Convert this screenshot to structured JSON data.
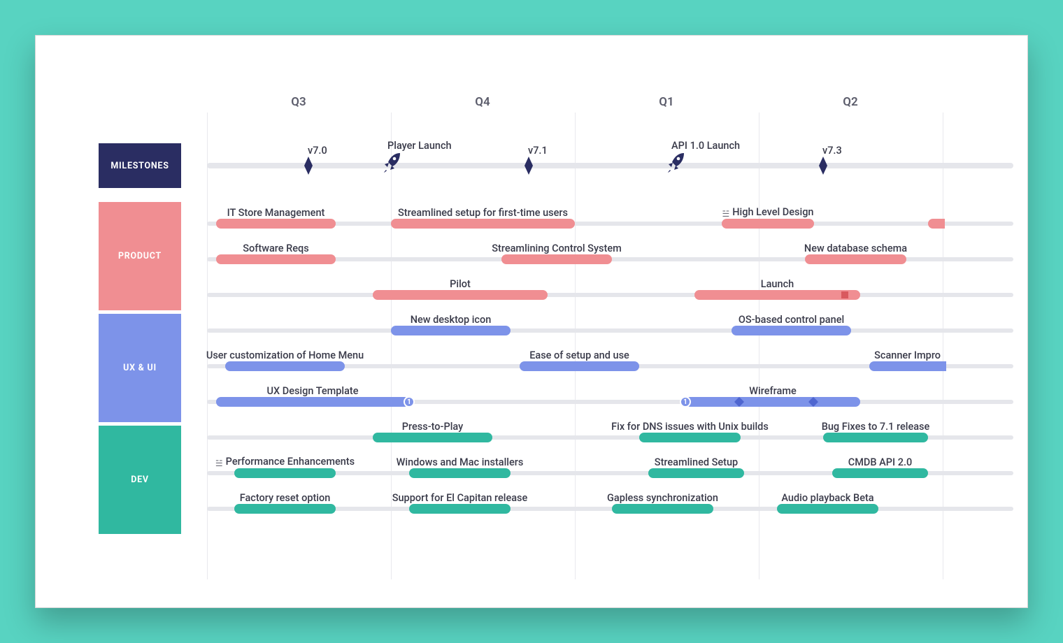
{
  "colors": {
    "milestones": "#2A2D62",
    "product": "#F08E92",
    "uxui": "#7D93E9",
    "dev": "#30B8A0"
  },
  "quarters": [
    "Q3",
    "Q4",
    "Q1",
    "Q2"
  ],
  "lanes": {
    "milestones": "MILESTONES",
    "product": "PRODUCT",
    "uxui": "UX & UI",
    "dev": "DEV"
  },
  "milestones": [
    {
      "label": "v7.0",
      "type": "diamond"
    },
    {
      "label": "Player Launch",
      "type": "rocket"
    },
    {
      "label": "v7.1",
      "type": "diamond"
    },
    {
      "label": "API 1.0 Launch",
      "type": "rocket"
    },
    {
      "label": "v7.3",
      "type": "diamond"
    }
  ],
  "product": {
    "r1": [
      {
        "label": "IT Store Management"
      },
      {
        "label": "Streamlined setup for first-time users"
      },
      {
        "label": "High Level Design",
        "tag": true
      }
    ],
    "r2": [
      {
        "label": "Software Reqs"
      },
      {
        "label": "Streamlining Control System"
      },
      {
        "label": "New database schema"
      }
    ],
    "r3": [
      {
        "label": "Pilot"
      },
      {
        "label": "Launch"
      }
    ]
  },
  "uxui": {
    "r1": [
      {
        "label": "New desktop icon"
      },
      {
        "label": "OS-based control panel"
      }
    ],
    "r2": [
      {
        "label": "User customization of Home Menu"
      },
      {
        "label": "Ease of setup and use"
      },
      {
        "label": "Scanner Impro"
      }
    ],
    "r3": [
      {
        "label": "UX Design Template",
        "badge": "1"
      },
      {
        "label": "Wireframe",
        "badge": "1"
      }
    ]
  },
  "dev": {
    "r1": [
      {
        "label": "Press-to-Play"
      },
      {
        "label": "Fix for DNS issues with Unix builds"
      },
      {
        "label": "Bug Fixes to 7.1 release"
      }
    ],
    "r2": [
      {
        "label": "Performance Enhancements",
        "tag": true
      },
      {
        "label": "Windows and Mac installers"
      },
      {
        "label": "Streamlined Setup"
      },
      {
        "label": "CMDB API 2.0"
      }
    ],
    "r3": [
      {
        "label": "Factory reset option"
      },
      {
        "label": "Support for El Capitan release"
      },
      {
        "label": "Gapless synchronization"
      },
      {
        "label": "Audio playback Beta"
      }
    ]
  },
  "chart_data": {
    "type": "gantt-roadmap",
    "time_axis": {
      "unit": "quarter",
      "labels": [
        "Q3",
        "Q4",
        "Q1",
        "Q2"
      ],
      "domain": [
        0,
        4
      ]
    },
    "swimlanes": [
      {
        "name": "MILESTONES",
        "color": "#2A2D62",
        "rows": [
          [
            {
              "kind": "milestone",
              "shape": "diamond",
              "label": "v7.0",
              "x": 0.55
            },
            {
              "kind": "milestone",
              "shape": "rocket",
              "label": "Player Launch",
              "x": 1.0
            },
            {
              "kind": "milestone",
              "shape": "rocket",
              "label": "API 1.0 Launch",
              "x": 2.55
            },
            {
              "kind": "milestone",
              "shape": "diamond",
              "label": "v7.1",
              "x": 1.75
            },
            {
              "kind": "milestone",
              "shape": "diamond",
              "label": "v7.3",
              "x": 3.35
            }
          ]
        ]
      },
      {
        "name": "PRODUCT",
        "color": "#F08E92",
        "rows": [
          [
            {
              "label": "IT Store Management",
              "start": 0.05,
              "end": 0.7
            },
            {
              "label": "Streamlined setup for first-time users",
              "start": 1.0,
              "end": 2.0
            },
            {
              "label": "High Level Design",
              "start": 2.8,
              "end": 3.3,
              "tag": true
            },
            {
              "label": "",
              "start": 3.92,
              "end": 4.0
            }
          ],
          [
            {
              "label": "Software Reqs",
              "start": 0.05,
              "end": 0.7
            },
            {
              "label": "Streamlining Control System",
              "start": 1.6,
              "end": 2.2
            },
            {
              "label": "New database schema",
              "start": 3.25,
              "end": 3.8
            }
          ],
          [
            {
              "label": "Pilot",
              "start": 0.9,
              "end": 1.85
            },
            {
              "label": "Launch",
              "start": 2.65,
              "end": 3.55,
              "marker": "square"
            }
          ]
        ]
      },
      {
        "name": "UX & UI",
        "color": "#7D93E9",
        "rows": [
          [
            {
              "label": "New desktop icon",
              "start": 1.0,
              "end": 1.65
            },
            {
              "label": "OS-based control panel",
              "start": 2.85,
              "end": 3.5
            }
          ],
          [
            {
              "label": "User customization of Home Menu",
              "start": 0.1,
              "end": 0.75
            },
            {
              "label": "Ease of setup and use",
              "start": 1.7,
              "end": 2.35
            },
            {
              "label": "Scanner Impro",
              "start": 3.6,
              "end": 4.0
            }
          ],
          [
            {
              "label": "UX Design Template",
              "start": 0.05,
              "end": 1.05,
              "end_badge": "1"
            },
            {
              "label": "Wireframe",
              "start": 2.75,
              "end": 3.55,
              "start_badge": "1",
              "diamonds_x": [
                2.95,
                3.35
              ]
            }
          ]
        ]
      },
      {
        "name": "DEV",
        "color": "#30B8A0",
        "rows": [
          [
            {
              "label": "Press-to-Play",
              "start": 0.9,
              "end": 1.55
            },
            {
              "label": "Fix for DNS issues with Unix builds",
              "start": 2.35,
              "end": 2.9
            },
            {
              "label": "Bug Fixes to 7.1 release",
              "start": 3.35,
              "end": 3.92
            }
          ],
          [
            {
              "label": "Performance Enhancements",
              "start": 0.15,
              "end": 0.7,
              "tag": true
            },
            {
              "label": "Windows and Mac installers",
              "start": 1.1,
              "end": 1.65
            },
            {
              "label": "Streamlined Setup",
              "start": 2.4,
              "end": 2.92
            },
            {
              "label": "CMDB API 2.0",
              "start": 3.4,
              "end": 3.92
            }
          ],
          [
            {
              "label": "Factory reset option",
              "start": 0.15,
              "end": 0.7
            },
            {
              "label": "Support for El Capitan release",
              "start": 1.1,
              "end": 1.65
            },
            {
              "label": "Gapless synchronization",
              "start": 2.2,
              "end": 2.75
            },
            {
              "label": "Audio playback Beta",
              "start": 3.1,
              "end": 3.65
            }
          ]
        ]
      }
    ]
  }
}
